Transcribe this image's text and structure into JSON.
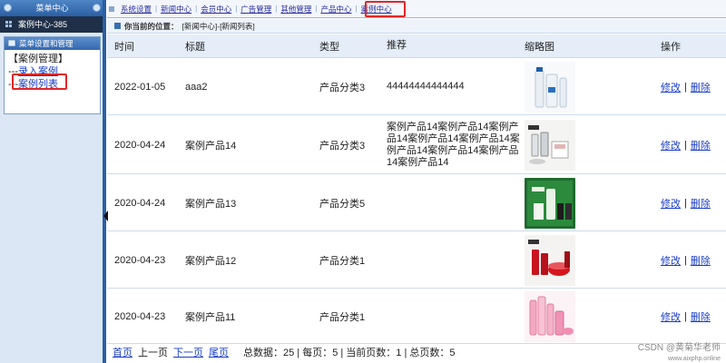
{
  "sidebar": {
    "menu_title": "菜单中心",
    "section_title": "案例中心-385",
    "box_title": "菜单设置和管理",
    "group_label": "【案例管理】",
    "items": [
      {
        "prefix": "---",
        "label": "录入案例"
      },
      {
        "prefix": "---",
        "label": "案例列表"
      }
    ]
  },
  "topnav": {
    "items": [
      "系统设置",
      "新闻中心",
      "会员中心",
      "广告管理",
      "其他管理",
      "产品中心",
      "案例中心"
    ],
    "active": "案例中心"
  },
  "location": {
    "label": "你当前的位置：",
    "path": "[新闻中心]-[新闻列表]"
  },
  "table": {
    "headers": [
      "时间",
      "标题",
      "类型",
      "推荐",
      "缩略图",
      "操作"
    ],
    "rows": [
      {
        "time": "2022-01-05",
        "title": "aaa2",
        "type": "产品分类3",
        "rec": "44444444444444",
        "thumb": "thumb-white-tubes"
      },
      {
        "time": "2020-04-24",
        "title": "案例产品14",
        "type": "产品分类3",
        "rec": "案例产品14案例产品14案例产品14案例产品14案例产品14案例产品14案例产品14案例产品14案例产品14",
        "thumb": "thumb-olay-white"
      },
      {
        "time": "2020-04-24",
        "title": "案例产品13",
        "type": "产品分类5",
        "rec": "",
        "thumb": "thumb-green-set"
      },
      {
        "time": "2020-04-23",
        "title": "案例产品12",
        "type": "产品分类1",
        "rec": "",
        "thumb": "thumb-olay-red"
      },
      {
        "time": "2020-04-23",
        "title": "案例产品11",
        "type": "产品分类1",
        "rec": "",
        "thumb": "thumb-pink-bottles"
      }
    ],
    "ops": {
      "edit": "修改",
      "sep": "|",
      "delete": "删除"
    }
  },
  "pager": {
    "first": "首页",
    "prev": "上一页",
    "next": "下一页",
    "last": "尾页",
    "stats": "总数据：25 | 每页：5 | 当前页数：1 | 总页数：5"
  },
  "watermark": {
    "text": "CSDN @黄菊华老师",
    "url": "www.aixphp.online"
  },
  "colors": {
    "link": "#1a3cc8",
    "highlight": "#e0262a",
    "header_bg": "#e4edf8"
  }
}
